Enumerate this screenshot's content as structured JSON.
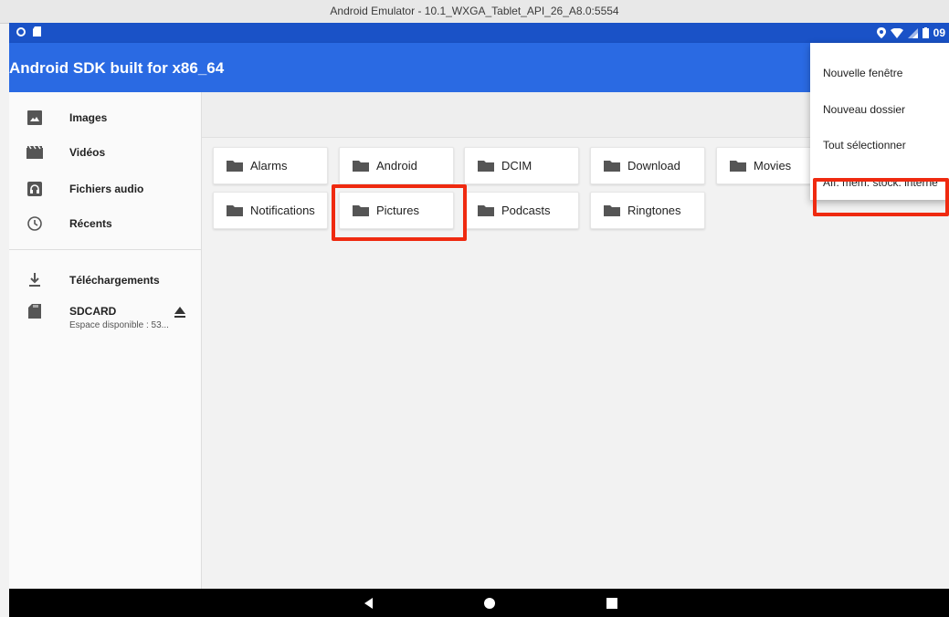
{
  "window_title": "Android Emulator - 10.1_WXGA_Tablet_API_26_A8.0:5554",
  "status_bar": {
    "time": "09",
    "icons": [
      "location-icon",
      "wifi-icon",
      "signal-icon",
      "battery-icon"
    ]
  },
  "app_bar": {
    "title": "Android SDK built for x86_64"
  },
  "sidebar": {
    "items": [
      {
        "label": "Images",
        "icon": "image-icon"
      },
      {
        "label": "Vidéos",
        "icon": "video-icon"
      },
      {
        "label": "Fichiers audio",
        "icon": "audio-icon"
      },
      {
        "label": "Récents",
        "icon": "clock-icon"
      },
      {
        "label": "Téléchargements",
        "icon": "download-icon"
      },
      {
        "label": "SDCARD",
        "sublabel": "Espace disponible : 53...",
        "icon": "sdcard-icon"
      }
    ]
  },
  "folders": [
    {
      "name": "Alarms"
    },
    {
      "name": "Android"
    },
    {
      "name": "DCIM"
    },
    {
      "name": "Download"
    },
    {
      "name": "Movies"
    },
    {
      "name": "Notifications"
    },
    {
      "name": "Pictures"
    },
    {
      "name": "Podcasts"
    },
    {
      "name": "Ringtones"
    }
  ],
  "overflow_menu": {
    "items": [
      {
        "label": "Nouvelle fenêtre"
      },
      {
        "label": "Nouveau dossier"
      },
      {
        "label": "Tout sélectionner"
      },
      {
        "label": "Aff. mém. stock. interne"
      }
    ]
  },
  "colors": {
    "status_bar": "#1a52c7",
    "app_bar": "#2a6ae3",
    "highlight": "#ef2a10"
  }
}
